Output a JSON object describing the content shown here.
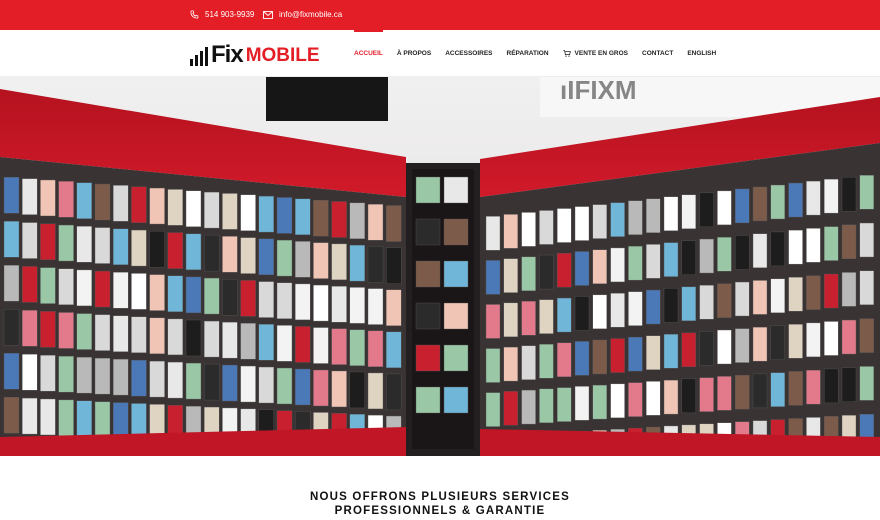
{
  "topbar": {
    "phone": "514 903-9939",
    "email": "info@fixmobile.ca",
    "phone_icon": "phone-icon",
    "email_icon": "envelope-icon",
    "background": "#e41e26"
  },
  "logo": {
    "part1": "Fix",
    "part2": "MOBILE",
    "accent": "#e41e26"
  },
  "nav": {
    "items": [
      {
        "label": "ACCUEIL",
        "active": true
      },
      {
        "label": "À PROPOS"
      },
      {
        "label": "ACCESSOIRES"
      },
      {
        "label": "RÉPARATION"
      },
      {
        "label": "VENTE EN GROS",
        "icon": "cart-icon"
      },
      {
        "label": "CONTACT"
      },
      {
        "label": "ENGLISH"
      }
    ]
  },
  "hero": {
    "subject": "store-display-photo",
    "colors": {
      "shelf_red": "#c4162a",
      "wall": "#ececec"
    }
  },
  "section": {
    "title_line1": "NOUS OFFRONS PLUSIEURS SERVICES",
    "title_line2": "PROFESSIONNELS & GARANTIE"
  }
}
